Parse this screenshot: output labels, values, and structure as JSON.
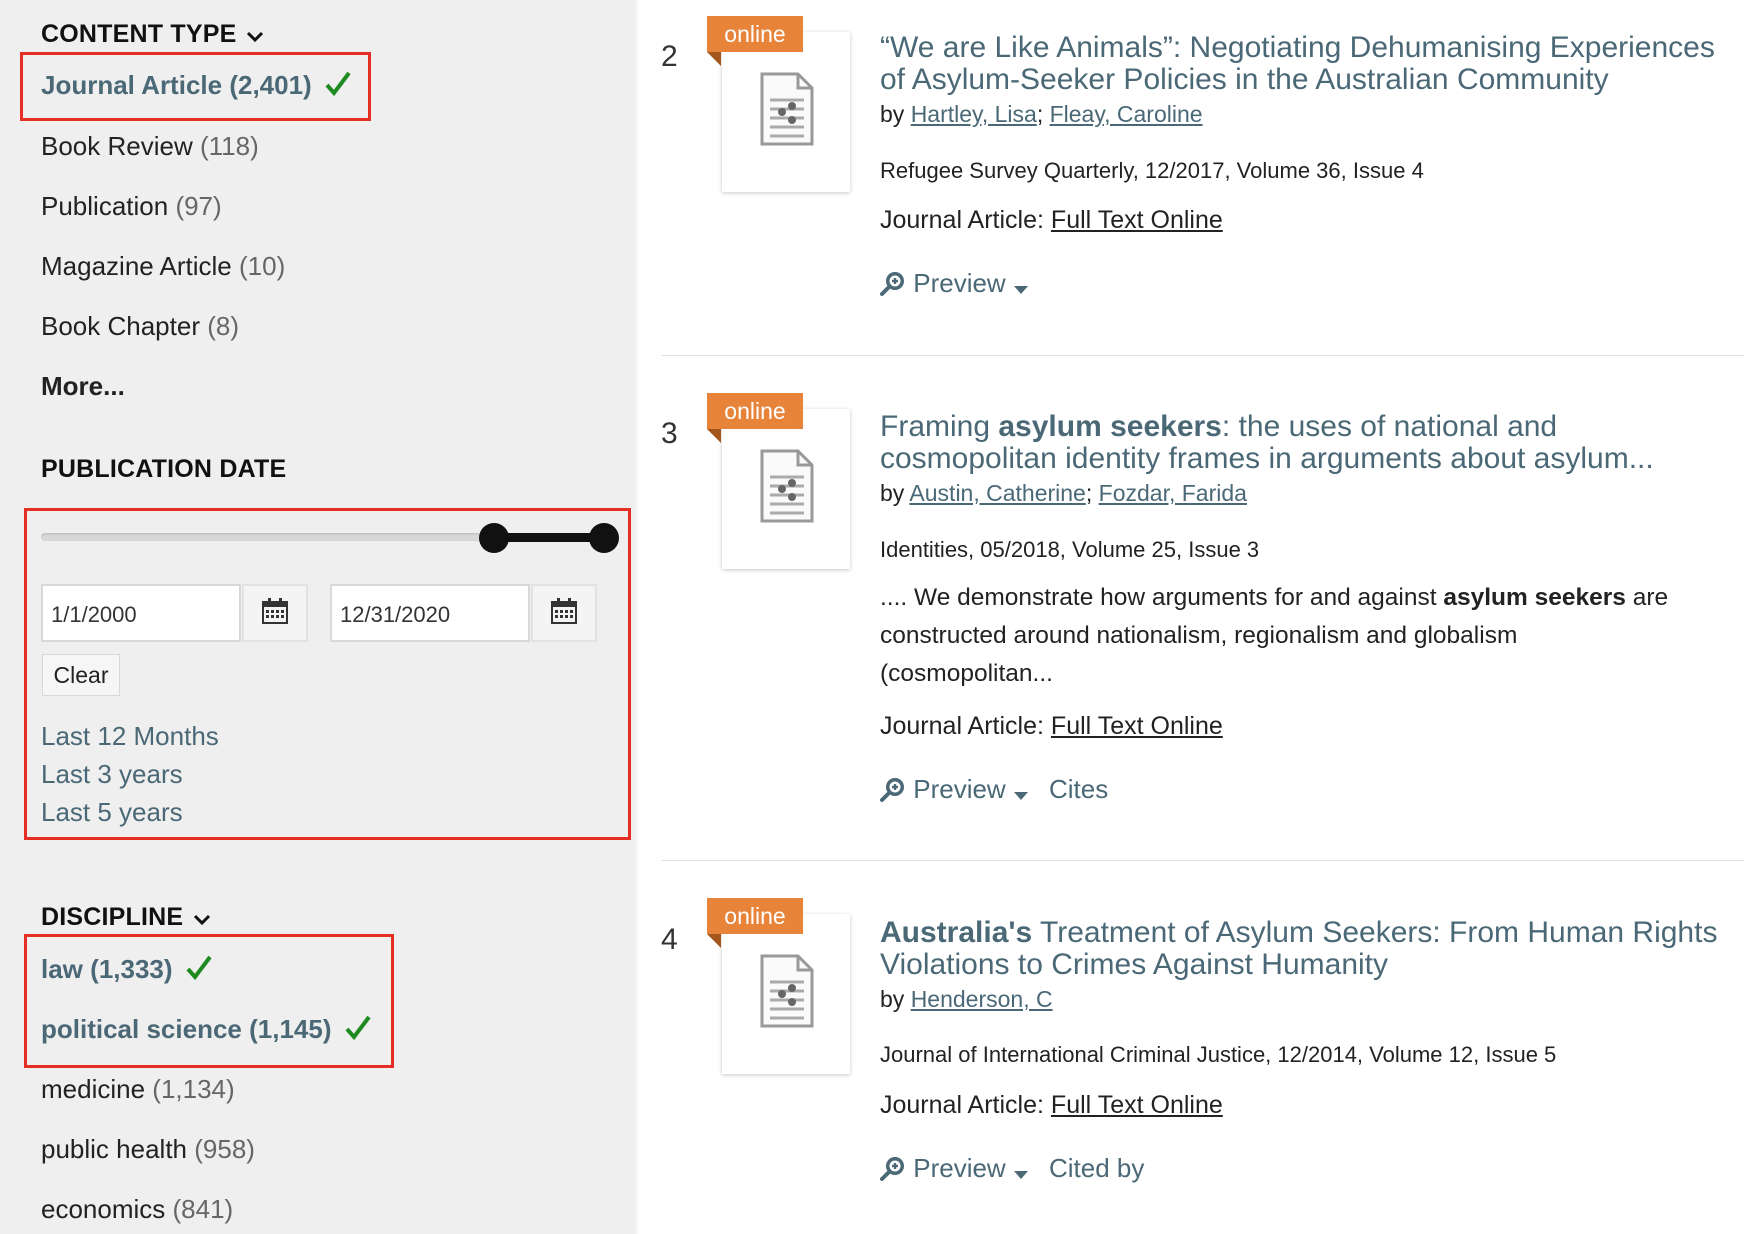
{
  "sidebar": {
    "content_type": {
      "heading": "CONTENT TYPE",
      "items": [
        {
          "label": "Journal Article",
          "count": "(2,401)"
        },
        {
          "label": "Book Review",
          "count": "(118)"
        },
        {
          "label": "Publication",
          "count": "(97)"
        },
        {
          "label": "Magazine Article",
          "count": "(10)"
        },
        {
          "label": "Book Chapter",
          "count": "(8)"
        }
      ],
      "more_label": "More..."
    },
    "publication_date": {
      "heading": "PUBLICATION DATE",
      "from_date": "1/1/2000",
      "to_date": "12/31/2020",
      "clear_label": "Clear",
      "links": [
        "Last 12 Months",
        "Last 3 years",
        "Last 5 years"
      ]
    },
    "discipline": {
      "heading": "DISCIPLINE",
      "items": [
        {
          "label": "law",
          "count": "(1,333)"
        },
        {
          "label": "political science",
          "count": "(1,145)"
        },
        {
          "label": "medicine",
          "count": "(1,134)"
        },
        {
          "label": "public health",
          "count": "(958)"
        },
        {
          "label": "economics",
          "count": "(841)"
        }
      ]
    }
  },
  "results": [
    {
      "number": "2",
      "badge": "online",
      "title_line1": "“We are Like Animals”: Negotiating Dehumanising Experiences",
      "title_line2": "of Asylum-Seeker Policies in the Australian Community",
      "by": "by",
      "authors": [
        "Hartley, Lisa",
        "Fleay, Caroline"
      ],
      "source": "Refugee Survey Quarterly, 12/2017, Volume 36, Issue 4",
      "type_label": "Journal Article:",
      "fulltext_label": "Full Text Online",
      "preview_label": "Preview"
    },
    {
      "number": "3",
      "badge": "online",
      "title_pre": "Framing ",
      "title_bold": "asylum seekers",
      "title_post": ": the uses of national and",
      "title_line2": "cosmopolitan identity frames in arguments about asylum...",
      "by": "by",
      "authors": [
        "Austin, Catherine",
        "Fozdar, Farida"
      ],
      "source": "Identities, 05/2018, Volume 25, Issue 3",
      "snippet_pre": ".... We demonstrate how arguments for and against ",
      "snippet_bold": "asylum seekers",
      "snippet_post": " are",
      "snippet_line2": "constructed around nationalism, regionalism and globalism",
      "snippet_line3": "(cosmopolitan...",
      "type_label": "Journal Article:",
      "fulltext_label": "Full Text Online",
      "preview_label": "Preview",
      "extra_label": "Cites"
    },
    {
      "number": "4",
      "badge": "online",
      "title_bold": "Australia's",
      "title_post": " Treatment of Asylum Seekers: From Human Rights",
      "title_line2": "Violations to Crimes Against Humanity",
      "by": "by",
      "authors": [
        "Henderson, C"
      ],
      "source": "Journal of International Criminal Justice, 12/2014, Volume 12, Issue 5",
      "type_label": "Journal Article:",
      "fulltext_label": "Full Text Online",
      "preview_label": "Preview",
      "extra_label": "Cited by"
    }
  ],
  "colors": {
    "accent": "#4a6876",
    "badge": "#e8833a",
    "highlight_box": "#e62e25",
    "check": "#1f8a1f"
  }
}
